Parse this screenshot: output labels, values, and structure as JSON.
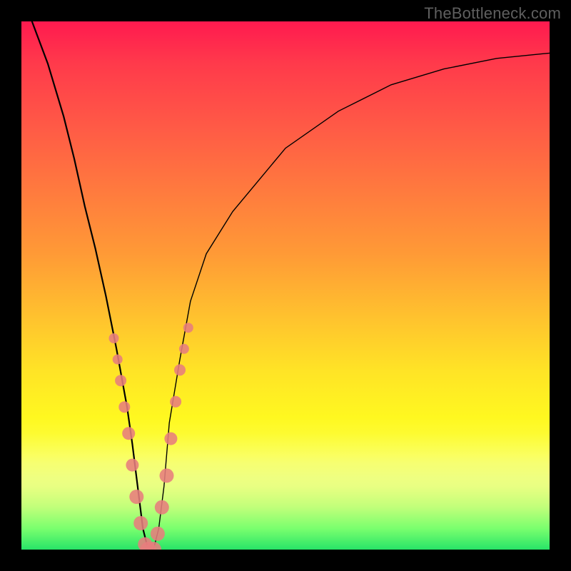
{
  "watermark": "TheBottleneck.com",
  "chart_data": {
    "type": "line",
    "title": "",
    "xlabel": "",
    "ylabel": "",
    "xlim": [
      0,
      100
    ],
    "ylim": [
      0,
      100
    ],
    "grid": false,
    "legend": false,
    "series": [
      {
        "name": "bottleneck-curve",
        "x": [
          2,
          5,
          8,
          10,
          12,
          14,
          16,
          18,
          20,
          21,
          22,
          23,
          24,
          25,
          26,
          27,
          28,
          30,
          32,
          35,
          40,
          50,
          60,
          70,
          80,
          90,
          100
        ],
        "values": [
          100,
          92,
          82,
          74,
          65,
          57,
          48,
          38,
          27,
          20,
          12,
          4,
          0,
          0,
          4,
          12,
          24,
          36,
          47,
          56,
          64,
          76,
          83,
          88,
          91,
          93,
          94
        ]
      }
    ],
    "markers": {
      "name": "highlight-points",
      "x": [
        17.5,
        18.2,
        18.8,
        19.5,
        20.3,
        21.0,
        21.8,
        22.6,
        23.4,
        24.0,
        25.0,
        25.8,
        26.6,
        27.5,
        28.3,
        29.2,
        30.0,
        30.8,
        31.6
      ],
      "values": [
        40,
        36,
        32,
        27,
        22,
        16,
        10,
        5,
        1,
        0,
        0,
        3,
        8,
        14,
        21,
        28,
        34,
        38,
        42
      ],
      "radius": [
        7,
        7,
        8,
        8,
        9,
        9,
        10,
        10,
        10,
        11,
        11,
        10,
        10,
        10,
        9,
        8,
        8,
        7,
        7
      ]
    },
    "annotations": []
  },
  "colors": {
    "marker": "#e77d7d",
    "curve": "#000000",
    "frame": "#000000"
  }
}
